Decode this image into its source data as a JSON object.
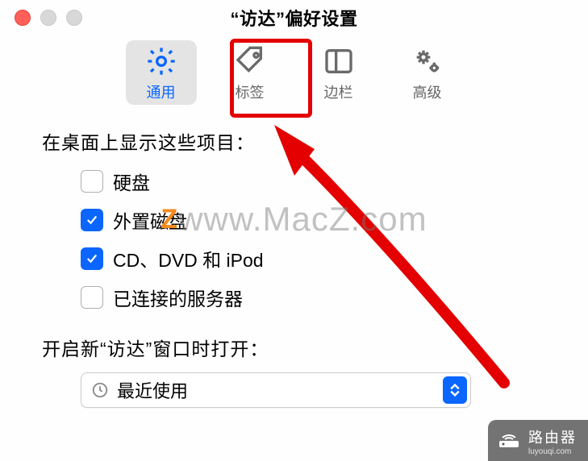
{
  "window": {
    "title": "“访达”偏好设置"
  },
  "tabs": [
    {
      "label": "通用",
      "icon": "gear",
      "selected": true
    },
    {
      "label": "标签",
      "icon": "tag",
      "selected": false
    },
    {
      "label": "边栏",
      "icon": "sidebar",
      "selected": false
    },
    {
      "label": "高级",
      "icon": "gears",
      "selected": false
    }
  ],
  "section_desktop": {
    "label": "在桌面上显示这些项目：",
    "options": [
      {
        "label": "硬盘",
        "checked": false
      },
      {
        "label": "外置磁盘",
        "checked": true
      },
      {
        "label": "CD、DVD 和 iPod",
        "checked": true
      },
      {
        "label": "已连接的服务器",
        "checked": false
      }
    ]
  },
  "section_new_window": {
    "label": "开启新“访达”窗口时打开：",
    "select_value": "最近使用"
  },
  "watermark": {
    "prefix": "",
    "z": "Z",
    "text": "www.MacZ.com"
  },
  "footer": {
    "brand": "路由器",
    "domain": "luyouqi.com"
  },
  "annotation": {
    "highlight_tab_index": 1,
    "arrow": true
  }
}
